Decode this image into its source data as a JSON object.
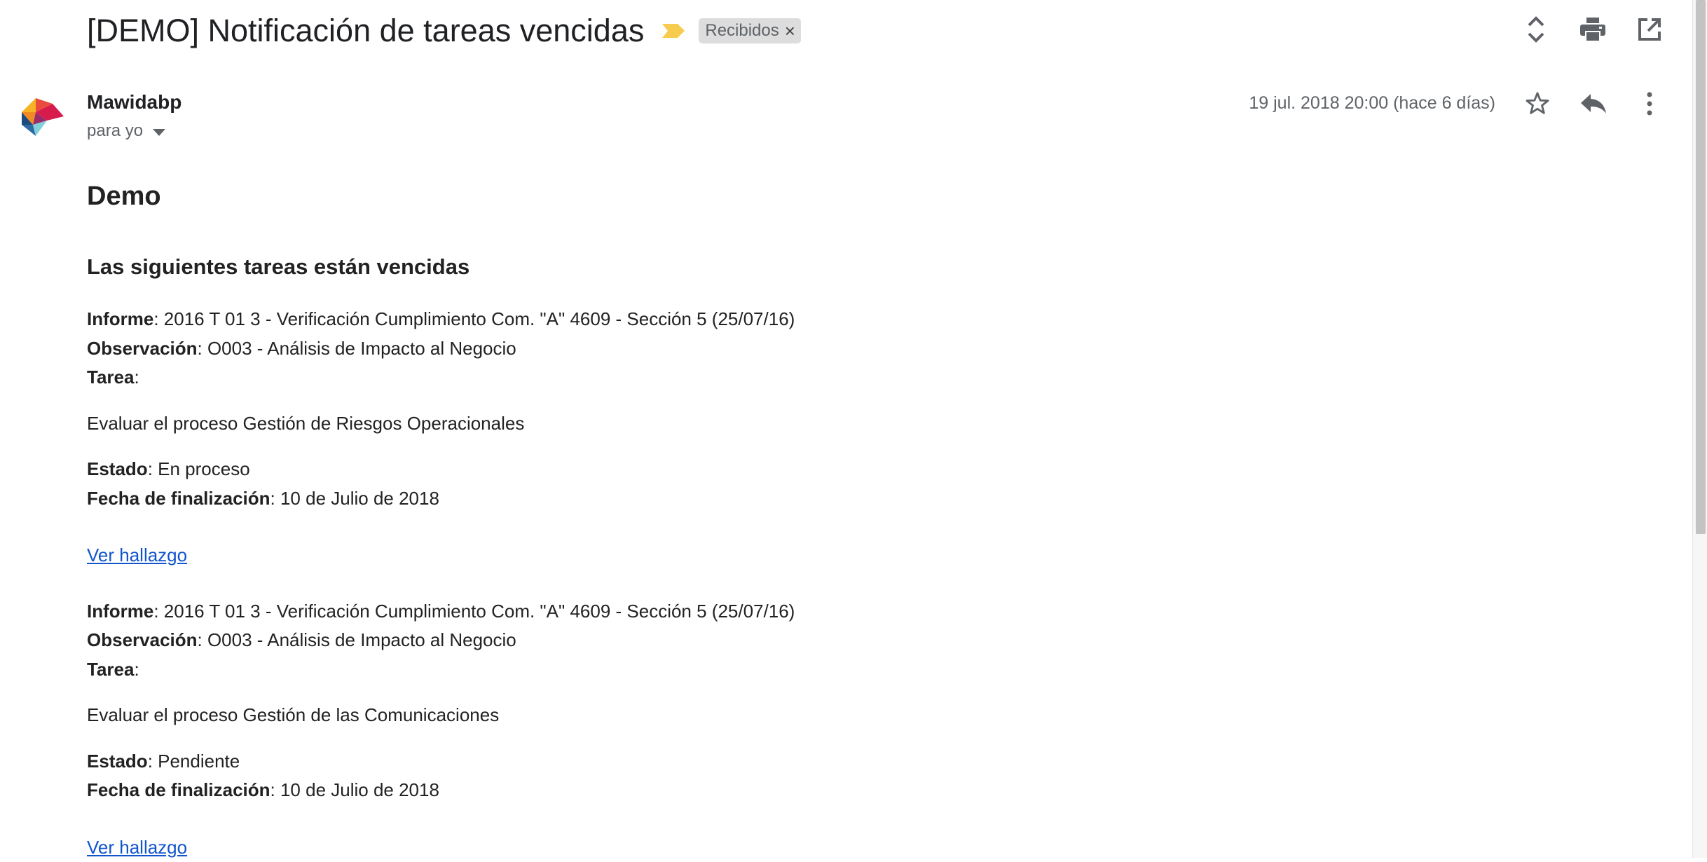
{
  "header": {
    "subject": "[DEMO] Notificación de tareas vencidas",
    "label": "Recibidos",
    "label_remove": "×",
    "importance_color": "#f7cb4d",
    "icons": [
      "expand-collapse-icon",
      "print-icon",
      "open-in-new-window-icon"
    ]
  },
  "message": {
    "sender": "Mawidabp",
    "recipient": "para yo",
    "date": "19 jul. 2018 20:00 (hace 6 días)",
    "icons": [
      "star-icon",
      "reply-icon",
      "more-vert-icon"
    ]
  },
  "body": {
    "title": "Demo",
    "subtitle": "Las siguientes tareas están vencidas",
    "tasks": [
      {
        "informe_label": "Informe",
        "informe": ": 2016 T 01 3 - Verificación Cumplimiento Com. \"A\" 4609 - Sección 5 (25/07/16)",
        "observacion_label": "Observación",
        "observacion": ": O003 - Análisis de Impacto al Negocio",
        "tarea_label": "Tarea",
        "tarea_sep": ":",
        "tarea": "Evaluar el proceso Gestión de Riesgos Operacionales",
        "estado_label": "Estado",
        "estado": ": En proceso",
        "fecha_label": "Fecha de finalización",
        "fecha": ": 10 de Julio de 2018",
        "link": "Ver hallazgo"
      },
      {
        "informe_label": "Informe",
        "informe": ": 2016 T 01 3 - Verificación Cumplimiento Com. \"A\" 4609 - Sección 5 (25/07/16)",
        "observacion_label": "Observación",
        "observacion": ": O003 - Análisis de Impacto al Negocio",
        "tarea_label": "Tarea",
        "tarea_sep": ":",
        "tarea": "Evaluar el proceso Gestión de las Comunicaciones",
        "estado_label": "Estado",
        "estado": ": Pendiente",
        "fecha_label": "Fecha de finalización",
        "fecha": ": 10 de Julio de 2018",
        "link": "Ver hallazgo"
      }
    ]
  },
  "colors": {
    "link": "#1155cc",
    "text": "#202124",
    "muted": "#5f6368",
    "chip_bg": "#dddddd"
  }
}
